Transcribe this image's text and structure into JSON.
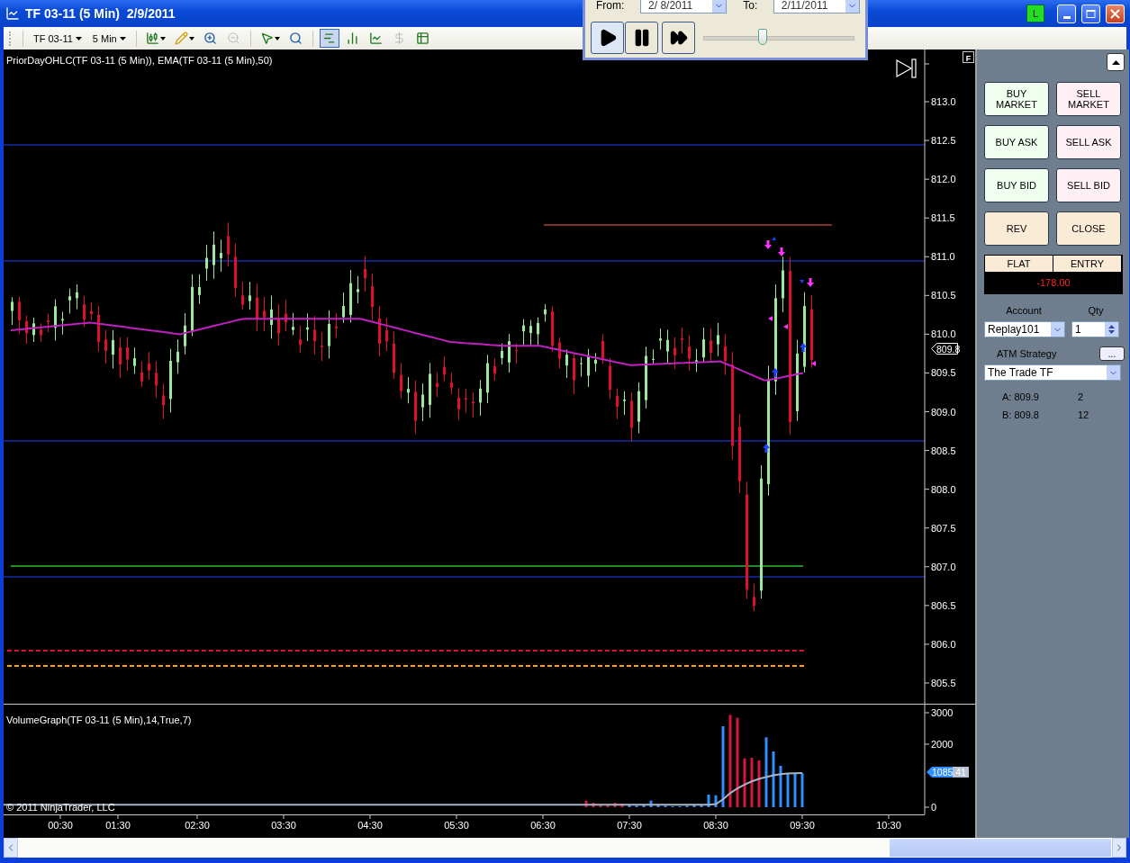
{
  "window": {
    "title": "TF 03-11 (5 Min)  2/9/2011",
    "connection_badge": "L"
  },
  "toolbar": {
    "instrument": "TF 03-11",
    "interval": "5 Min",
    "tools": [
      {
        "kind": "candles",
        "selected": false,
        "disabled": false
      },
      {
        "kind": "pencil",
        "selected": false,
        "disabled": false
      },
      {
        "kind": "zoom-in",
        "selected": false,
        "disabled": false
      },
      {
        "kind": "zoom-out",
        "selected": false,
        "disabled": true
      },
      {
        "kind": "pointer",
        "selected": false,
        "disabled": false
      },
      {
        "kind": "magnifier",
        "selected": false,
        "disabled": false
      },
      {
        "kind": "order-bars",
        "selected": true,
        "disabled": false
      },
      {
        "kind": "candle-chart",
        "selected": false,
        "disabled": false
      },
      {
        "kind": "line-chart",
        "selected": false,
        "disabled": false
      },
      {
        "kind": "dollar",
        "selected": false,
        "disabled": true
      },
      {
        "kind": "table",
        "selected": false,
        "disabled": false
      }
    ]
  },
  "replay": {
    "from_label": "From:",
    "from_value": "2/ 8/2011",
    "to_label": "To:",
    "to_value": "2/11/2011",
    "speed": {
      "level": 0.39
    }
  },
  "chart": {
    "indicator_label": "PriorDayOHLC(TF 03-11 (5 Min)), EMA(TF 03-11 (5 Min),50)",
    "panel_flag": "F",
    "price_ticks": [
      "813.0",
      "812.5",
      "812.0",
      "811.5",
      "811.0",
      "810.5",
      "810.0",
      "809.5",
      "809.0",
      "808.5",
      "808.0",
      "807.5",
      "807.0",
      "806.5",
      "806.0",
      "805.5"
    ],
    "last_price": "809.8",
    "volume": {
      "label": "VolumeGraph(TF 03-11 (5 Min),14,True,7)",
      "copyright": "© 2011 NinjaTrader, LLC",
      "last_value": "1085.41",
      "axis_labels": [
        "3000",
        "2000",
        "0"
      ]
    },
    "time_labels": [
      "00:30",
      "01:30",
      "02:30",
      "03:30",
      "04:30",
      "05:30",
      "06:30",
      "07:30",
      "08:30",
      "09:30",
      "10:30"
    ]
  },
  "order_panel": {
    "buttons": [
      {
        "label": "BUY\nMARKET",
        "kind": "buy"
      },
      {
        "label": "SELL\nMARKET",
        "kind": "sell"
      },
      {
        "label": "BUY ASK",
        "kind": "buy"
      },
      {
        "label": "SELL ASK",
        "kind": "sell"
      },
      {
        "label": "BUY BID",
        "kind": "buy"
      },
      {
        "label": "SELL BID",
        "kind": "sell"
      },
      {
        "label": "REV",
        "kind": "neutral"
      },
      {
        "label": "CLOSE",
        "kind": "neutral"
      }
    ],
    "position": {
      "status": "FLAT",
      "entry_label": "ENTRY",
      "pnl": "-178.00"
    },
    "account": {
      "label": "Account",
      "value": "Replay101"
    },
    "quantity": {
      "label": "Qty",
      "value": "1"
    },
    "atm_strategy": {
      "label": "ATM Strategy",
      "button": "...",
      "value": "The Trade TF"
    },
    "quotes": [
      {
        "label": "A: 809.9",
        "size": "2"
      },
      {
        "label": "B: 809.8",
        "size": "12"
      }
    ]
  }
}
